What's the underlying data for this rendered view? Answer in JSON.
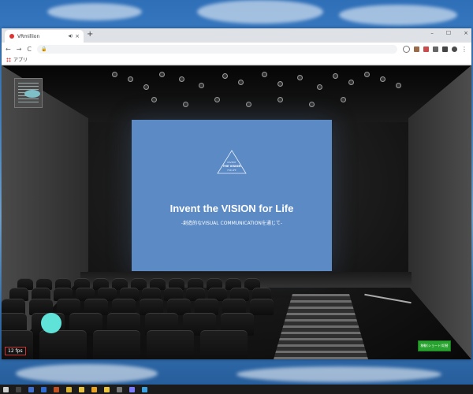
{
  "browser": {
    "tab_title": "VRmillion",
    "mute_glyph": "◀)",
    "close_glyph": "×",
    "new_tab_glyph": "+",
    "window_controls": {
      "minimize": "–",
      "maximize": "☐",
      "close": "×"
    },
    "nav": {
      "back": "←",
      "forward": "→",
      "reload": "C"
    },
    "address": "",
    "lock_glyph": "🔒",
    "bookmarks_bar_label": "アプリ",
    "extension_colors": [
      "#777777",
      "#9a6b4a",
      "#c94d4d",
      "#666666",
      "#444444",
      "#4a4a4a"
    ]
  },
  "scene": {
    "screen": {
      "logo_small": "INVENT",
      "logo_main": "THE VISION",
      "logo_bottom": "FOR LIFE",
      "title": "Invent the VISION for Life",
      "subtitle": "-創造的なVISUAL COMMUNICATIONを通じて-"
    },
    "fps_label": "12 fps",
    "green_button_label": "移動(ショート)切替",
    "joystick_color": "#5fe3d8",
    "screen_color": "#5b8ac5"
  },
  "taskbar": {
    "icon_colors": [
      "#cccccc",
      "#444444",
      "#3c6fd0",
      "#2d6ad1",
      "#c05020",
      "#d8b030",
      "#e6c040",
      "#e8a020",
      "#e9c23d",
      "#777777",
      "#7a7aff",
      "#3aa0e0"
    ]
  }
}
